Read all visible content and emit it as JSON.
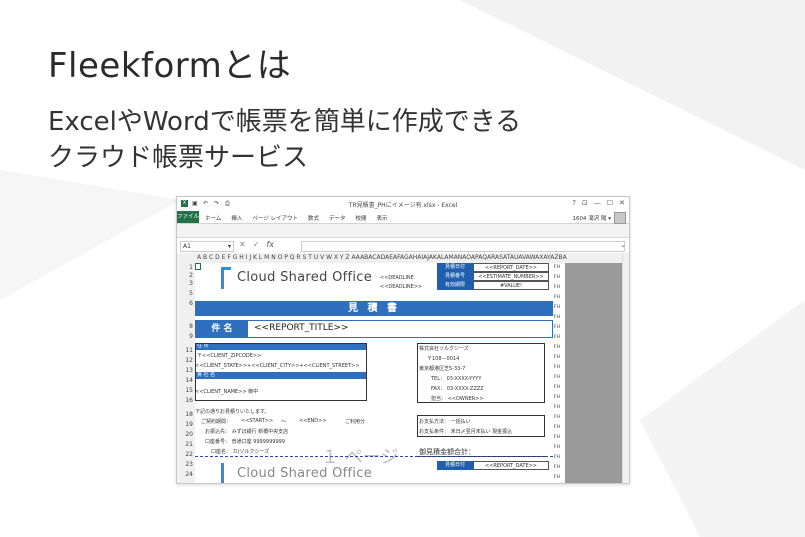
{
  "heading": {
    "title": "Fleekformとは",
    "subtitle_line1": "ExcelやWordで帳票を簡単に作成できる",
    "subtitle_line2": "クラウド帳票サービス"
  },
  "excel": {
    "window_title": "TR見積書_PHにイメージ有.xlsx - Excel",
    "window_controls": [
      "?",
      "⊡",
      "—",
      "☐",
      "✕"
    ],
    "ribbon_tabs": [
      "ファイル",
      "ホーム",
      "挿入",
      "ページ レイアウト",
      "数式",
      "データ",
      "校閲",
      "表示"
    ],
    "user": "1604 滝沢 陽 ▾",
    "name_box": "A1",
    "columns": "A B C D E F G H I J K L M N O P Q R S T U V W X Y Z AAABACADAEAFAGAHAIAJAKALAMANAOAPAQARASATAUAVAWAXAYAZBA",
    "rows": [
      "1",
      "2",
      "3",
      "5",
      "6",
      "8",
      "9",
      "11",
      "12",
      "13",
      "14",
      "15",
      "16",
      "18",
      "19",
      "20",
      "21",
      "22",
      "23",
      "24"
    ],
    "fh_marks": "FH",
    "sheet": {
      "logo_text": "Cloud Shared Office",
      "deadline1": "<<DEADLINE",
      "deadline2": "<<DEADLINE>>",
      "label_date": "見積日付",
      "label_number": "見積番号",
      "label_valid": "有効期限",
      "val_date": "<<REPORT_DATE>>",
      "val_number": "<<ESTIMATE_NUMBER>>",
      "val_valid": "#VALUE!",
      "doc_title": "見 積 書",
      "subject_label": "件 名",
      "subject_value": "<<REPORT_TITLE>>",
      "addr_label": "住 所",
      "zip": "〒<<CLIENT_ZIPCODE>>",
      "addr": "<<CLIENT_STATE>>+<<CLIENT_CITY>>+<<CLIENT_STREET>>",
      "company_label": "貴 社 名",
      "client": "<<CLIENT_NAME>>  御中",
      "issuer_company": "株式会社ソルクシーズ",
      "issuer_zip": "〒108－0014",
      "issuer_addr": "東京都港区芝5-33-7",
      "issuer_tel": "TEL： 03-XXXX-YYYY",
      "issuer_fax": "FAX： 03-XXXX-ZZZZ",
      "issuer_owner": "担当： <<OWNER>>",
      "note": "下記の通りお見積りいたします。",
      "contract_label": "ご契約期間：",
      "contract_start": "<<START>>",
      "tilde": "～",
      "contract_end": "<<END>>",
      "usage": "ご利用分",
      "bank": "お振込先： みずほ銀行 新橋中央支店",
      "account": "口座番号： 普通口座 9999999999",
      "account_name": "口座名： カ)ソルクシーズ",
      "pay_method": "お支払方法： 一括払い",
      "pay_terms": "お支払条件： 末日〆翌月末払い 現金振込",
      "total_label": "御見積金額合計：",
      "page_mark": "１ ページ",
      "logo_text2": "Cloud Shared Office",
      "val_date2": "<<REPORT_DATE>>"
    }
  }
}
